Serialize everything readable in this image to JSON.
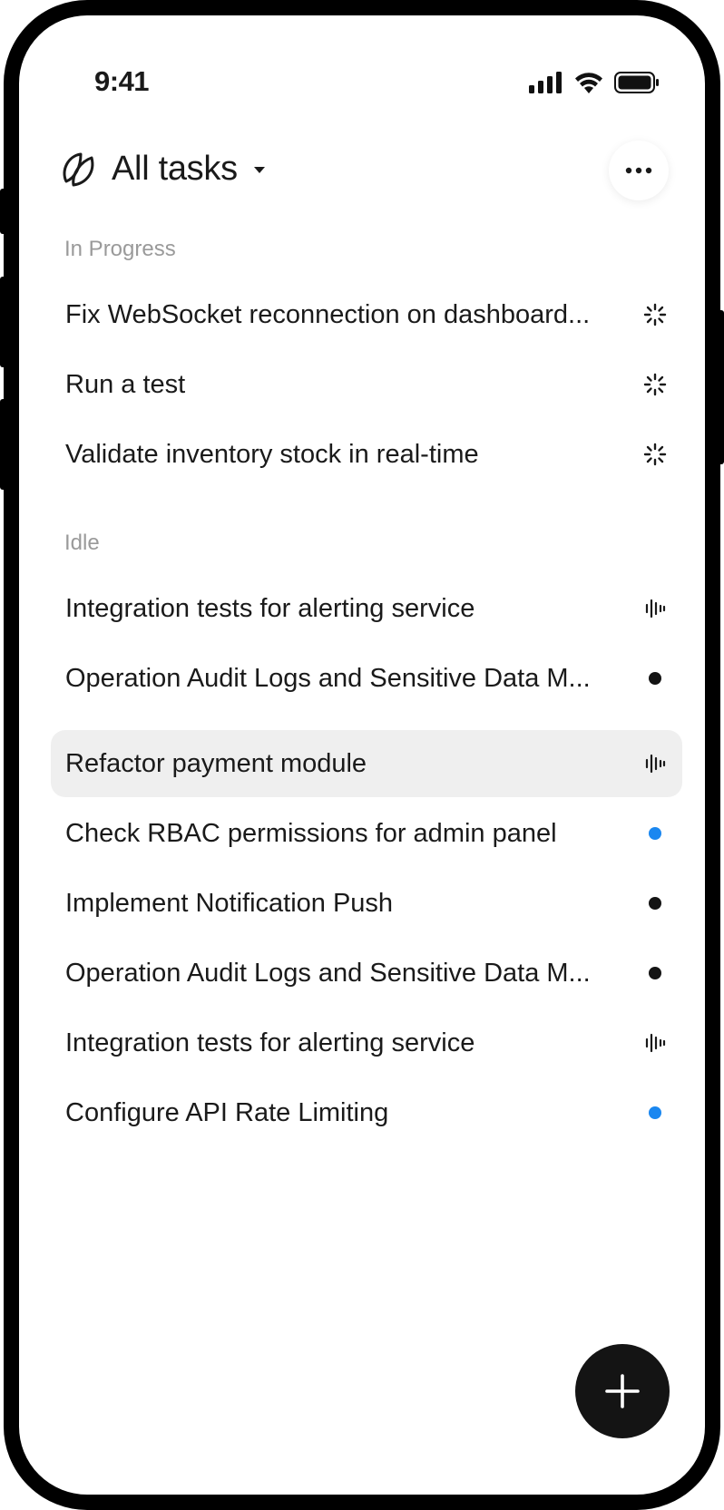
{
  "status_bar": {
    "time": "9:41"
  },
  "header": {
    "title": "All tasks",
    "logo_icon": "overlapping-leaves-icon",
    "dropdown_icon": "caret-down-icon",
    "more_icon": "ellipsis-icon"
  },
  "sections": [
    {
      "label": "In Progress",
      "tasks": [
        {
          "title": "Fix WebSocket reconnection on dashboard...",
          "status": "spinner"
        },
        {
          "title": "Run a test",
          "status": "spinner"
        },
        {
          "title": "Validate inventory stock in real-time",
          "status": "spinner"
        }
      ]
    },
    {
      "label": "Idle",
      "tasks": [
        {
          "title": "Integration tests for alerting service",
          "status": "waveform"
        },
        {
          "title": "Operation Audit Logs and Sensitive Data M...",
          "status": "dot-black"
        },
        {
          "title": "Refactor payment module",
          "status": "waveform",
          "selected": true
        },
        {
          "title": "Check RBAC permissions for admin panel",
          "status": "dot-blue"
        },
        {
          "title": "Implement Notification Push",
          "status": "dot-black"
        },
        {
          "title": "Operation Audit Logs and Sensitive Data M...",
          "status": "dot-black"
        },
        {
          "title": "Integration tests for alerting service",
          "status": "waveform"
        },
        {
          "title": "Configure API Rate Limiting",
          "status": "dot-blue"
        }
      ]
    }
  ],
  "colors": {
    "accent_blue": "#1a87f0",
    "dot_black": "#141414",
    "selected_bg": "#efefef",
    "section_label": "#9a9a9a"
  },
  "fab": {
    "icon": "plus-icon"
  }
}
